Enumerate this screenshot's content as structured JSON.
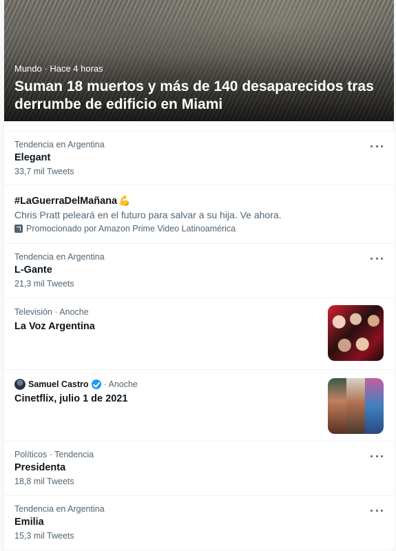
{
  "hero": {
    "category": "Mundo",
    "time": "Hace 4 horas",
    "title": "Suman 18 muertos y más de 140 desaparecidos tras derrumbe de edificio en Miami"
  },
  "trends": [
    {
      "context": "Tendencia en Argentina",
      "name": "Elegant",
      "count": "33,7 mil Tweets"
    },
    {
      "context": "Tendencia en Argentina",
      "name": "L-Gante",
      "count": "21,3 mil Tweets"
    },
    {
      "context": "Políticos · Tendencia",
      "name": "Presidenta",
      "count": "18,8 mil Tweets"
    },
    {
      "context": "Tendencia en Argentina",
      "name": "Emilia",
      "count": "15,3 mil Tweets"
    }
  ],
  "promo": {
    "hashtag": "#LaGuerraDelMañana",
    "description": "Chris Pratt peleará en el futuro para salvar a su hija. Ve ahora.",
    "promoted_by": "Promocionado por Amazon Prime Video Latinoamérica"
  },
  "voz": {
    "meta": "Televisión · Anoche",
    "title": "La Voz Argentina"
  },
  "cinetflix": {
    "author": "Samuel Castro",
    "time": "· Anoche",
    "title": "Cinetflix, julio 1 de 2021"
  },
  "icons": {
    "more": "more-horizontal-icon",
    "promoted": "promoted-icon",
    "verified": "verified-badge-icon",
    "emoji": "flexed-biceps-emoji"
  },
  "colors": {
    "text_primary": "#0f1419",
    "text_secondary": "#536471",
    "verified": "#1d9bf0",
    "divider": "#eff3f4"
  }
}
